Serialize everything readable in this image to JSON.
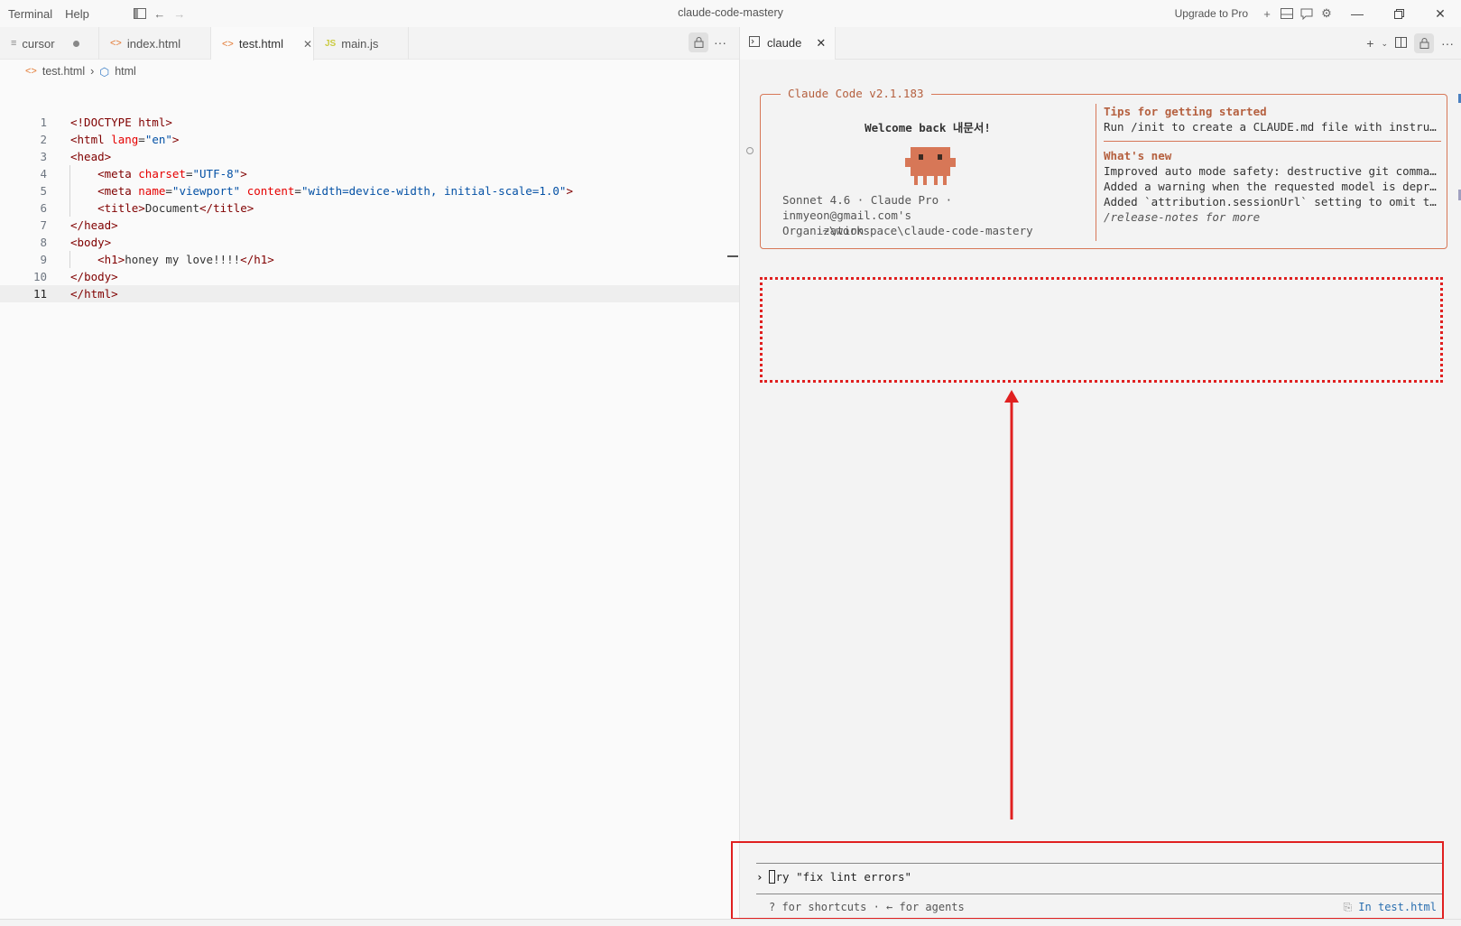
{
  "titlebar": {
    "menu": [
      "Terminal",
      "Help"
    ],
    "title": "claude-code-mastery",
    "upgrade_label": "Upgrade to Pro"
  },
  "editor": {
    "tabs": [
      {
        "label": "cursor",
        "icon": "menu-lines-icon",
        "modified": true
      },
      {
        "label": "index.html",
        "icon": "html-icon"
      },
      {
        "label": "test.html",
        "icon": "html-icon",
        "active": true
      },
      {
        "label": "main.js",
        "icon": "js-icon",
        "icon_text": "JS"
      }
    ],
    "breadcrumb": [
      "test.html",
      "html"
    ],
    "line_numbers": [
      "1",
      "2",
      "3",
      "4",
      "5",
      "6",
      "7",
      "8",
      "9",
      "10",
      "11"
    ],
    "code": {
      "l1": "<!DOCTYPE html>",
      "l2_tag": "html",
      "l2_attr": "lang",
      "l2_val": "\"en\"",
      "l3": "head",
      "l4_tag": "meta",
      "l4_attr": "charset",
      "l4_val": "\"UTF-8\"",
      "l5_tag": "meta",
      "l5_attr1": "name",
      "l5_val1": "\"viewport\"",
      "l5_attr2": "content",
      "l5_val2": "\"width=device-width, initial-scale=1.0\"",
      "l6_tag": "title",
      "l6_text": "Document",
      "l7": "head",
      "l8": "body",
      "l9_tag": "h1",
      "l9_text": "honey my love!!!!",
      "l10": "body",
      "l11": "html"
    }
  },
  "claude_panel": {
    "tab_label": "claude",
    "welcome": {
      "legend": "Claude Code v2.1.183",
      "greeting": "Welcome back 내문서!",
      "meta_line1": "Sonnet 4.6 · Claude Pro · inmyeon@gmail.com's",
      "meta_line2": "Organization",
      "path": "~\\workspace\\claude-code-mastery",
      "tips_heading": "Tips for getting started",
      "tips_line": "Run /init to create a CLAUDE.md file with instructions for Claude",
      "whats_new_heading": "What's new",
      "news": [
        "Improved auto mode safety: destructive git commands are blocked",
        "Added a warning when the requested model is deprecated",
        "Added `attribution.sessionUrl` setting to omit the commit URL"
      ],
      "release_notes": "/release-notes for more"
    },
    "prompt_placeholder": "Try \"fix lint errors\"",
    "prompt_rest": "ry \"fix lint errors\"",
    "hints": "? for shortcuts · ← for agents",
    "context_label": "In test.html"
  },
  "colors": {
    "accent": "#d77757",
    "annotation_red": "#e02020"
  }
}
